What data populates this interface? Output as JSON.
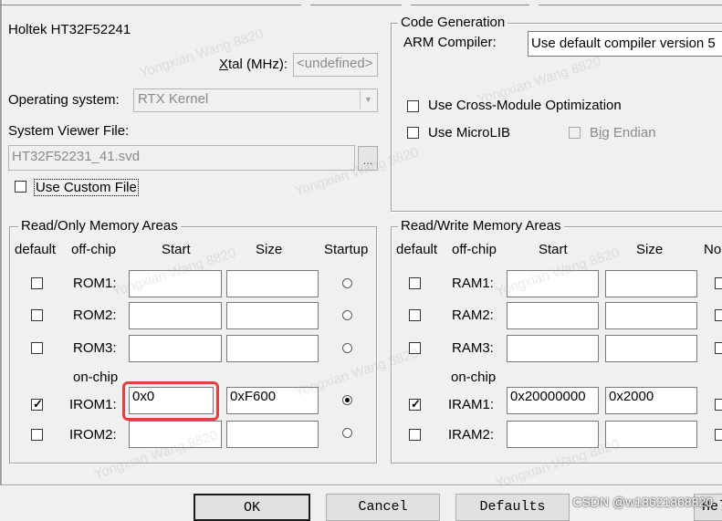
{
  "device": {
    "name": "Holtek HT32F52241"
  },
  "xtal": {
    "label_prefix": "X",
    "label_rest": "tal (MHz):",
    "value": "<undefined>"
  },
  "os": {
    "label": "Operating system:",
    "value": "RTX Kernel"
  },
  "svd": {
    "label": "System Viewer File:",
    "value": "HT32F52231_41.svd",
    "browse": "..."
  },
  "custom_file": {
    "label": "Use Custom File",
    "checked": false
  },
  "codegen": {
    "title": "Code Generation",
    "compiler_label": "ARM Compiler:",
    "compiler_value": "Use default compiler version 5",
    "cross_module": "Use Cross-Module Optimization",
    "microlib": "Use MicroLIB",
    "big_endian_prefix": "B",
    "big_endian_mid": "i",
    "big_endian_rest": "g Endian"
  },
  "ro": {
    "title": "Read/Only Memory Areas",
    "headers": {
      "default": "default",
      "offchip": "off-chip",
      "start": "Start",
      "size": "Size",
      "startup": "Startup"
    },
    "onchip_label": "on-chip",
    "rows": [
      {
        "name": "ROM1:",
        "start": "",
        "size": "",
        "default": false,
        "startup": false
      },
      {
        "name": "ROM2:",
        "start": "",
        "size": "",
        "default": false,
        "startup": false
      },
      {
        "name": "ROM3:",
        "start": "",
        "size": "",
        "default": false,
        "startup": false
      },
      {
        "name": "IROM1:",
        "start": "0x0",
        "size": "0xF600",
        "default": true,
        "startup": true
      },
      {
        "name": "IROM2:",
        "start": "",
        "size": "",
        "default": false,
        "startup": false
      }
    ]
  },
  "rw": {
    "title": "Read/Write Memory Areas",
    "headers": {
      "default": "default",
      "offchip": "off-chip",
      "start": "Start",
      "size": "Size",
      "noinit": "No"
    },
    "onchip_label": "on-chip",
    "rows": [
      {
        "name": "RAM1:",
        "start": "",
        "size": "",
        "default": false
      },
      {
        "name": "RAM2:",
        "start": "",
        "size": "",
        "default": false
      },
      {
        "name": "RAM3:",
        "start": "",
        "size": "",
        "default": false
      },
      {
        "name": "IRAM1:",
        "start": "0x20000000",
        "size": "0x2000",
        "default": true
      },
      {
        "name": "IRAM2:",
        "start": "",
        "size": "",
        "default": false
      }
    ]
  },
  "buttons": {
    "ok": "OK",
    "cancel": "Cancel",
    "defaults": "Defaults",
    "help": "Help"
  },
  "watermark": {
    "text": "Yongxian Wang 8820",
    "csdn": "CSDN @w18621868820"
  }
}
